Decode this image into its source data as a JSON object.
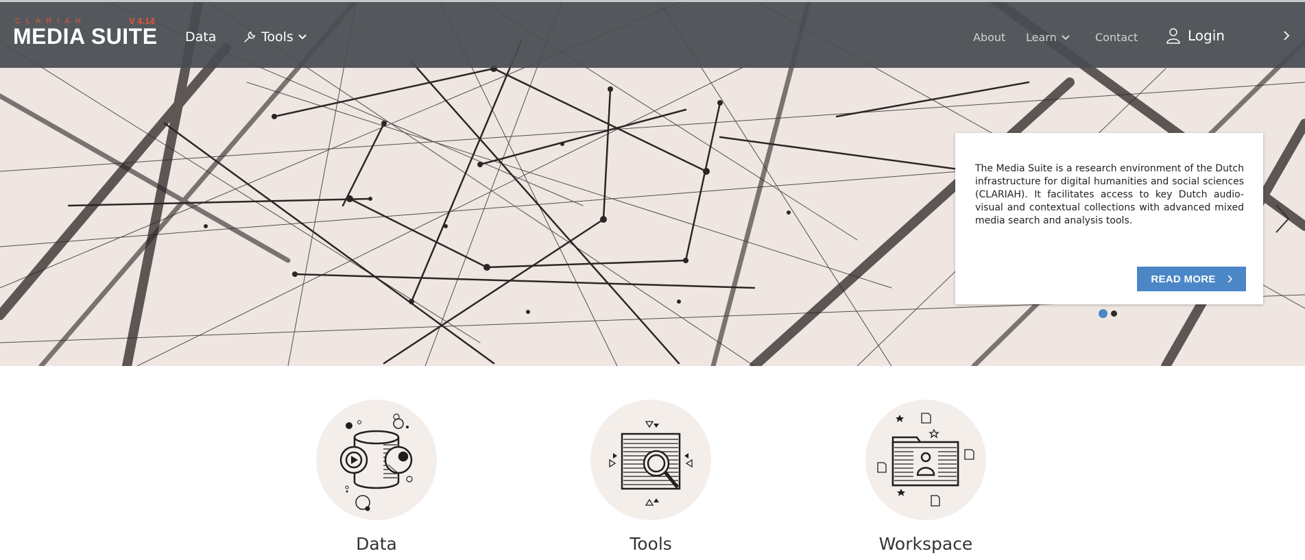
{
  "brand": {
    "top_text": "CLARIAH",
    "version": "V 4.14",
    "name": "MEDIA SUITE",
    "accent_color": "#e8533d"
  },
  "nav": {
    "data_label": "Data",
    "tools_label": "Tools",
    "about_label": "About",
    "learn_label": "Learn",
    "contact_label": "Contact",
    "login_label": "Login",
    "icons": [
      "wrench-icon",
      "chevron-down-icon",
      "user-icon",
      "chevron-right-icon"
    ]
  },
  "hero": {
    "description": "The Media Suite is a research environment of the Dutch infrastructure for digital humanities and social sciences (CLARIAH). It facilitates access to key Dutch audio-visual and contextual collections with advanced mixed media search and analysis tools.",
    "read_more_label": "READ MORE",
    "slides_total": 2,
    "active_slide": 1,
    "button_color": "#4b87c7"
  },
  "features": [
    {
      "label": "Data",
      "icon": "database-media-icon"
    },
    {
      "label": "Tools",
      "icon": "search-tool-icon"
    },
    {
      "label": "Workspace",
      "icon": "workspace-folder-icon"
    }
  ]
}
